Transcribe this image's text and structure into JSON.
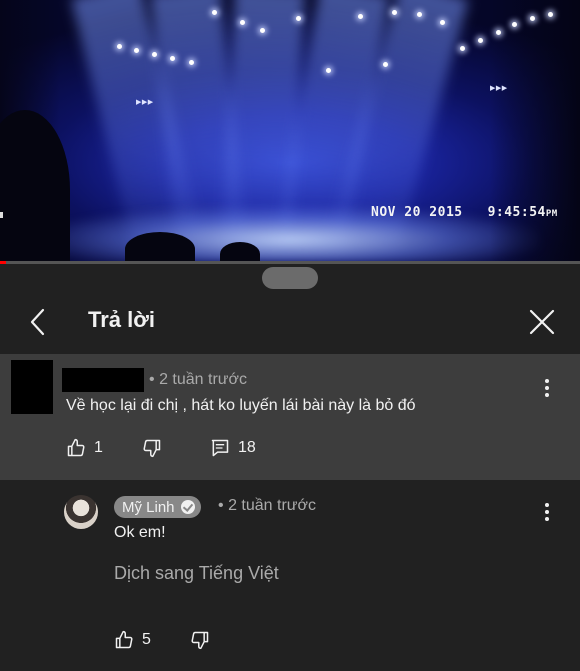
{
  "video": {
    "timestamp_date": "NOV 20 2015",
    "timestamp_time": "9:45:54",
    "timestamp_ampm": "PM",
    "progress_fraction": 0.01
  },
  "header": {
    "title": "Trả lời"
  },
  "parent_comment": {
    "author_redacted": true,
    "separator": "•",
    "time": "2 tuần trước",
    "text": "Về học lại đi chị , hát ko luyến lái bài này là bỏ đó",
    "likes": "1",
    "replies": "18"
  },
  "reply": {
    "author": "Mỹ Linh",
    "verified": true,
    "separator": "•",
    "time": "2 tuần trước",
    "text": "Ok em!",
    "translate_label": "Dịch sang Tiếng Việt",
    "likes": "5"
  },
  "colors": {
    "sheet_bg": "#212121",
    "highlight_bg": "#3d3d3d",
    "meta_text": "#aaaaaa",
    "progress": "#ff0000"
  }
}
